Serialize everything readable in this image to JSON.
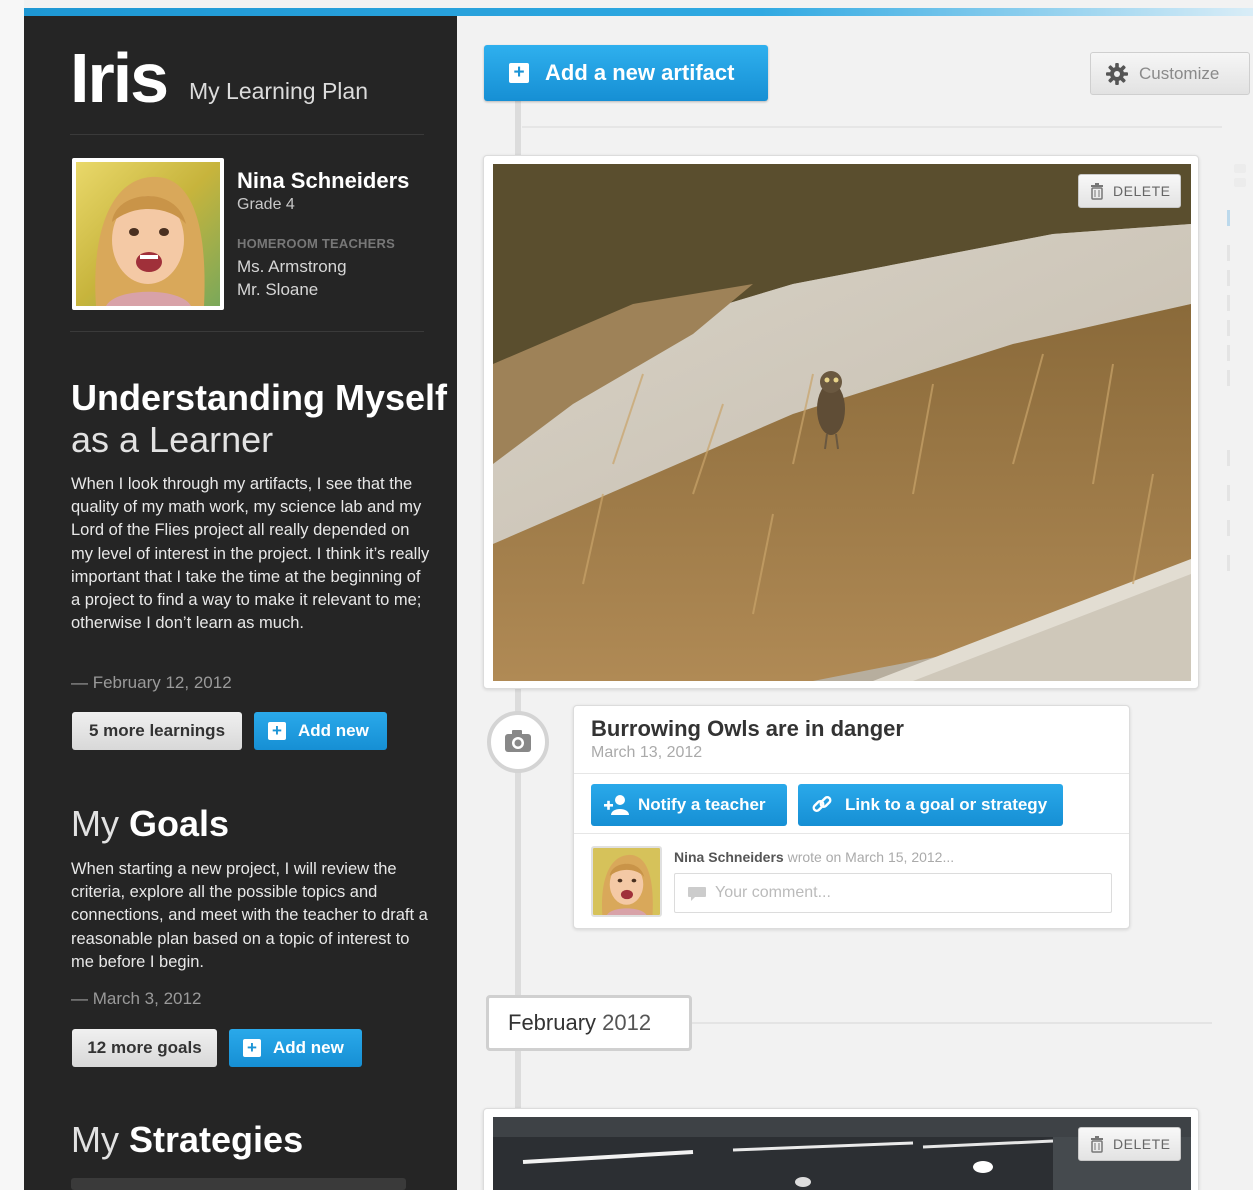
{
  "app": {
    "title": "Iris",
    "subtitle": "My Learning Plan"
  },
  "student": {
    "name": "Nina Schneiders",
    "grade": "Grade 4",
    "teachers_label": "HOMEROOM TEACHERS",
    "teachers": [
      "Ms. Armstrong",
      "Mr. Sloane"
    ]
  },
  "learner_section": {
    "heading_bold": "Understanding Myself",
    "heading_light": "as a Learner",
    "text": "When I look through my artifacts, I see that the quality of my math work, my science lab and my Lord of the Flies project all really depended on my level of interest in the project.  I think it’s really important that I take the time at the beginning of a project to find a way to make it relevant to me; otherwise I don’t learn as much.",
    "date": "— February 12, 2012",
    "more_button": "5 more learnings",
    "add_button": "Add new"
  },
  "goals_section": {
    "heading_light": "My",
    "heading_bold": "Goals",
    "text": "When starting a new project, I will review the criteria, explore all the possible topics and connections, and meet with the teacher to draft a reasonable plan based on a topic of interest to me before I begin.",
    "date": "— March 3, 2012",
    "more_button": "12 more goals",
    "add_button": "Add new"
  },
  "strategies_section": {
    "heading_light": "My",
    "heading_bold": "Strategies"
  },
  "toolbar": {
    "add_artifact": "Add a new artifact",
    "customize": "Customize"
  },
  "artifact": {
    "delete_label": "DELETE",
    "title": "Burrowing Owls are in danger",
    "date": "March 13, 2012",
    "notify_button": "Notify a teacher",
    "link_button": "Link to a goal or strategy",
    "comment_author": "Nina Schneiders",
    "comment_meta": "wrote on March 15, 2012...",
    "comment_placeholder": "Your comment..."
  },
  "month": {
    "name": "February",
    "year": "2012"
  },
  "artifact2": {
    "delete_label": "DELETE"
  },
  "colors": {
    "accent": "#1b94d6",
    "sidebar": "#252525",
    "background": "#f2f2f2"
  }
}
